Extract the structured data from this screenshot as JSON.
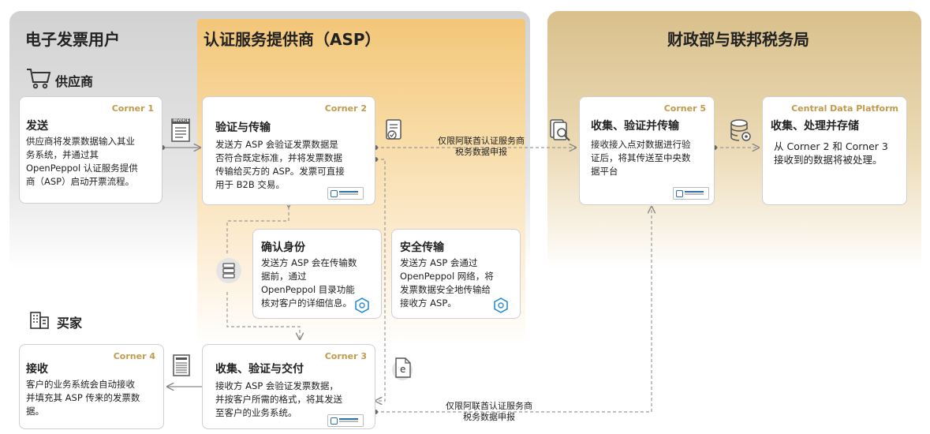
{
  "zones": {
    "users": "电子发票用户",
    "asp": "认证服务提供商（ASP）",
    "gov": "财政部与联邦税务局"
  },
  "roles": {
    "supplier": "供应商",
    "buyer": "买家"
  },
  "boxes": {
    "corner1": {
      "tag": "Corner 1",
      "title": "发送",
      "body": "供应商将发票数据输入其业\n务系统，并通过其\nOpenPeppol 认证服务提供\n商（ASP）启动开票流程。"
    },
    "corner2": {
      "tag": "Corner 2",
      "title": "验证与传输",
      "body": "发送方 ASP 会验证发票数据是\n否符合既定标准，并将发票数据\n传输给买方的 ASP。发票可直接\n用于 B2B 交易。"
    },
    "identity": {
      "title": "确认身份",
      "body": "发送方 ASP 会在传输数\n据前，通过\nOpenPeppol 目录功能\n核对客户的详细信息。"
    },
    "secure": {
      "title": "安全传输",
      "body": "发送方 ASP 会通过\nOpenPeppol 网络，将\n发票数据安全地传输给\n接收方 ASP。"
    },
    "corner3": {
      "tag": "Corner 3",
      "title": "收集、验证与交付",
      "body": "接收方 ASP 会验证发票数据，\n并按客户所需的格式，将其发送\n至客户的业务系统。"
    },
    "corner4": {
      "tag": "Corner 4",
      "title": "接收",
      "body": "客户的业务系统会自动接收\n并填充其 ASP 传来的发票数\n据。"
    },
    "corner5": {
      "tag": "Corner 5",
      "title": "收集、验证并传输",
      "body": "接收接入点对数据进行验\n证后，将其传送至中央数\n据平台"
    },
    "cdp": {
      "tag": "Central Data Platform",
      "title": "收集、处理并存储",
      "body": "从 Corner 2 和 Corner 3\n接收到的数据将被处理。"
    }
  },
  "arrow_labels": {
    "top": "仅限阿联酋认证服务商\n税务数据申报",
    "bottom": "仅限阿联酋认证服务商\n税务数据申报"
  },
  "icons": {
    "invoice_tag": "INVOICE",
    "e_doc": "e"
  },
  "colors": {
    "corner_tag": "#c29a4a",
    "peppol_blue": "#2a8fd0"
  }
}
